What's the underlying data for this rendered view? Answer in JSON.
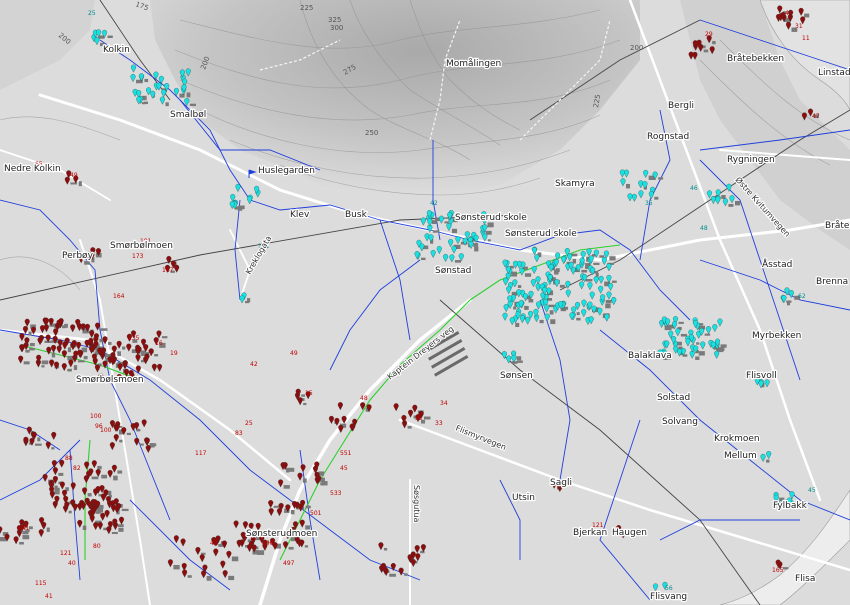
{
  "place_labels": [
    "Kolkin",
    "Smalbøl",
    "Nedre Kolkin",
    "Huslegarden",
    "Klev",
    "Busk",
    "Perbøy",
    "Smørbølmoen",
    "Smørbølsmoen",
    "Momålingen",
    "Skamyra",
    "Sønsterud skole",
    "Sønsterud skole",
    "Sønstad",
    "Sønsen",
    "Balaklava",
    "Solstad",
    "Solvang",
    "Krokmoen",
    "Mellum",
    "Sagli",
    "Utsin",
    "Bjerkan",
    "Haugen",
    "Sønsterudmoen",
    "Flisvang",
    "Flisa",
    "Fylbakk",
    "Flisvoll",
    "Myrbekken",
    "Brenna",
    "Åsstad",
    "Bråtebekken",
    "Bråtebekken",
    "Rygningen",
    "Rognstad",
    "Bergli",
    "Linstad"
  ],
  "road_labels": [
    "Kaptein Dreyers veg",
    "Flismyrvegen",
    "Søsgutua",
    "Kreklogata",
    "Østre Kvitumvegen"
  ],
  "contour_labels": [
    "175",
    "200",
    "225",
    "250",
    "275",
    "300",
    "325",
    "200",
    "200",
    "225"
  ],
  "address_numbers_red": [
    "65",
    "49",
    "181",
    "173",
    "167",
    "164",
    "42",
    "135",
    "16",
    "19",
    "15",
    "49",
    "48",
    "25",
    "32",
    "33",
    "34",
    "83",
    "100",
    "96",
    "117",
    "45",
    "551",
    "533",
    "501",
    "496",
    "497",
    "42",
    "115",
    "41",
    "40",
    "121",
    "80",
    "82",
    "141",
    "88",
    "100",
    "121",
    "165",
    "47",
    "29",
    "4",
    "11",
    "31"
  ],
  "address_numbers_cyan": [
    "25",
    "121",
    "42",
    "62",
    "45",
    "56",
    "58",
    "35",
    "46",
    "48"
  ],
  "colors": {
    "background": "#dcdcdc",
    "terrain": "#bdbdbd",
    "road": "#ffffff",
    "network_blue": "#1f3fdc",
    "network_green": "#2bd12b",
    "rail": "#444444",
    "river": "#ededed",
    "marker_red": "#8b0d0d",
    "marker_cyan": "#19e1e1",
    "building": "#7a7a7a"
  }
}
